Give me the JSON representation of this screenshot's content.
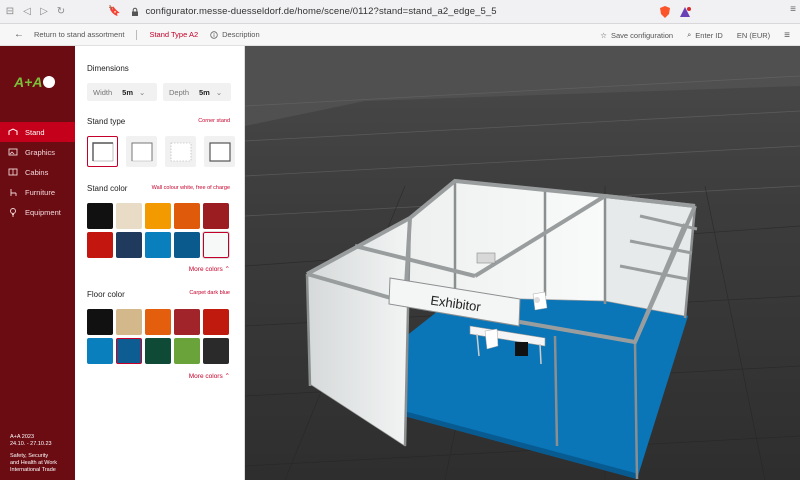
{
  "browser": {
    "url": "configurator.messe-duesseldorf.de/home/scene/0112?stand=stand_a2_edge_5_5"
  },
  "toolbar": {
    "back_label": "Return to stand assortment",
    "stand_type_label": "Stand Type A2",
    "description_label": "Description",
    "save_label": "Save configuration",
    "enter_id_label": "Enter ID",
    "locale_label": "EN (EUR)"
  },
  "sidebar": {
    "logo": "A+A",
    "items": [
      {
        "label": "Stand",
        "icon": "stand-icon",
        "active": true
      },
      {
        "label": "Graphics",
        "icon": "graphics-icon",
        "active": false
      },
      {
        "label": "Cabins",
        "icon": "cabins-icon",
        "active": false
      },
      {
        "label": "Furniture",
        "icon": "furniture-icon",
        "active": false
      },
      {
        "label": "Equipment",
        "icon": "equipment-icon",
        "active": false
      }
    ],
    "footer": {
      "event": "A+A 2023",
      "dates": "24.10. - 27.10.23",
      "line1": "Safety, Security",
      "line2": "and Health at Work",
      "line3": "International Trade"
    }
  },
  "panel": {
    "dimensions_title": "Dimensions",
    "width_label": "Width",
    "width_value": "5m",
    "depth_label": "Depth",
    "depth_value": "5m",
    "stand_type_title": "Stand type",
    "stand_type_note": "Corner stand",
    "stand_color_title": "Stand color",
    "stand_color_note": "Wall colour white, free of charge",
    "stand_colors": [
      "#111111",
      "#e9dcc6",
      "#f39a00",
      "#e05a0c",
      "#9b1d22",
      "#c3160f",
      "#1f3a5c",
      "#0a7fbd",
      "#0b5a8e",
      "#f7f9f9"
    ],
    "stand_color_selected": 9,
    "floor_color_title": "Floor color",
    "floor_color_note": "Carpet dark blue",
    "floor_colors": [
      "#111111",
      "#d3b88c",
      "#e35e0d",
      "#a2242b",
      "#c01a0f",
      "#0a7fbd",
      "#0d5c92",
      "#0e4a36",
      "#6aa33a",
      "#2a2a2a"
    ],
    "floor_color_selected": 6,
    "more_colors_label": "More colors"
  },
  "viewport": {
    "sign_text": "Exhibitor",
    "accent": "#c4002a"
  }
}
